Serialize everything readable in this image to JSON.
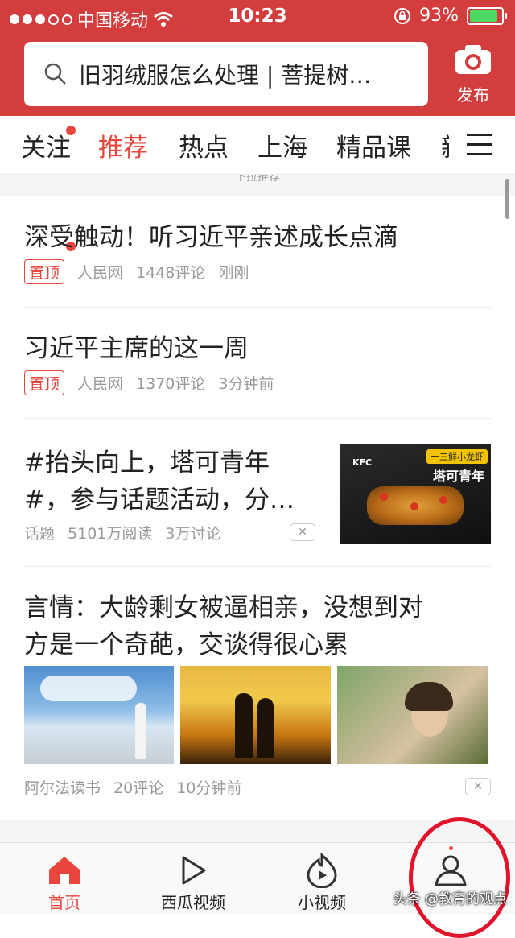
{
  "status_bar": {
    "carrier": "中国移动",
    "time": "10:23",
    "battery": "93%"
  },
  "search": {
    "query": "旧羽绒服怎么处理 | 菩提树…"
  },
  "publish": {
    "label": "发布"
  },
  "tabs": [
    "关注",
    "推荐",
    "热点",
    "上海",
    "精品课",
    "新"
  ],
  "pull_hint": "下拉推荐",
  "articles": [
    {
      "title": "深受触动！听习近平亲述成长点滴",
      "badge": "置顶",
      "source": "人民网",
      "comments": "1448评论",
      "time": "刚刚"
    },
    {
      "title": "习近平主席的这一周",
      "badge": "置顶",
      "source": "人民网",
      "comments": "1370评论",
      "time": "3分钟前"
    },
    {
      "title_line1": "#抬头向上，塔可青年",
      "title_line2": "#，参与话题活动，分…",
      "source": "话题",
      "reads": "5101万阅读",
      "discuss": "3万讨论",
      "ad_brand": "KFC",
      "ad_slogan": "十三鲜小龙虾",
      "ad_title": "塔可青年"
    },
    {
      "title_line1": "言情：大龄剩女被逼相亲，没想到对",
      "title_line2": "方是一个奇葩，交谈得很心累",
      "source": "阿尔法读书",
      "comments": "20评论",
      "time": "10分钟前"
    }
  ],
  "bottom_nav": [
    {
      "label": "首页",
      "icon": "home-icon",
      "active": true
    },
    {
      "label": "西瓜视频",
      "icon": "play-icon"
    },
    {
      "label": "小视频",
      "icon": "flame-play-icon"
    },
    {
      "label": "",
      "icon": "user-icon"
    }
  ],
  "watermark": "头条 @教育的观点",
  "colors": {
    "brand": "#d43d3d",
    "active": "#e8453c"
  }
}
